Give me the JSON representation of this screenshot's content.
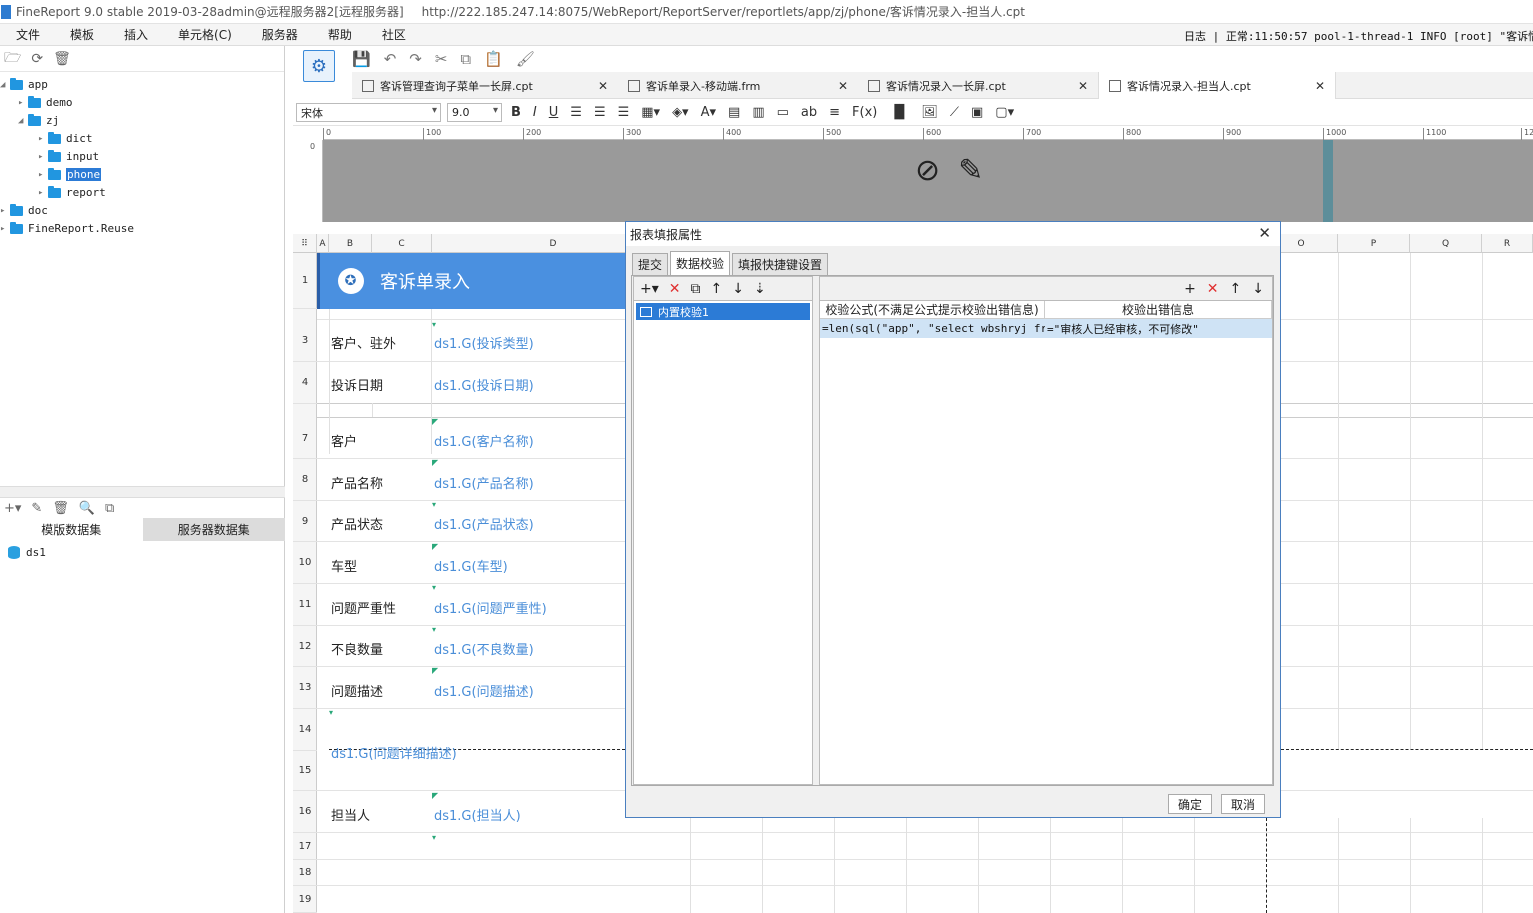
{
  "titlebar": {
    "title": "FineReport 9.0 stable 2019-03-28admin@远程服务器2[远程服务器]",
    "url": "http://222.185.247.14:8075/WebReport/ReportServer/reportlets/app/zj/phone/客诉情况录入-担当人.cpt"
  },
  "menu": {
    "items": [
      "文件",
      "模板",
      "插入",
      "单元格(C)",
      "服务器",
      "帮助",
      "社区"
    ],
    "log": "日志 | 正常:11:50:57 pool-1-thread-1 INFO [root] \"客诉情况"
  },
  "tree": {
    "nodes": [
      {
        "label": "app"
      },
      {
        "label": "demo"
      },
      {
        "label": "zj"
      },
      {
        "label": "dict"
      },
      {
        "label": "input"
      },
      {
        "label": "phone"
      },
      {
        "label": "report"
      },
      {
        "label": "doc"
      },
      {
        "label": "FineReport.Reuse"
      }
    ]
  },
  "datasets": {
    "tabs": [
      "模版数据集",
      "服务器数据集"
    ],
    "items": [
      "ds1"
    ]
  },
  "tabs": [
    {
      "label": "客诉管理查询子菜单一长屏.cpt"
    },
    {
      "label": "客诉单录入-移动端.frm"
    },
    {
      "label": "客诉情况录入一长屏.cpt"
    },
    {
      "label": "客诉情况录入-担当人.cpt"
    }
  ],
  "format": {
    "font": "宋体",
    "size": "9.0"
  },
  "ruler": [
    "0",
    "100",
    "200",
    "300",
    "400",
    "500",
    "600",
    "700",
    "800",
    "900",
    "1000",
    "1100",
    "12"
  ],
  "columns": [
    "A",
    "B",
    "C",
    "D",
    "O",
    "P",
    "Q",
    "R"
  ],
  "rows": [
    "1",
    "3",
    "4",
    "7",
    "8",
    "9",
    "10",
    "11",
    "12",
    "13",
    "14",
    "15",
    "16",
    "17",
    "18",
    "19"
  ],
  "sheet": {
    "header": "客诉单录入",
    "cells": [
      {
        "label": "客户、驻外",
        "value": "ds1.G(投诉类型)"
      },
      {
        "label": "投诉日期",
        "value": "ds1.G(投诉日期)"
      },
      {
        "label": "客户",
        "value": "ds1.G(客户名称)"
      },
      {
        "label": "产品名称",
        "value": "ds1.G(产品名称)"
      },
      {
        "label": "产品状态",
        "value": "ds1.G(产品状态)"
      },
      {
        "label": "车型",
        "value": "ds1.G(车型)"
      },
      {
        "label": "问题严重性",
        "value": "ds1.G(问题严重性)"
      },
      {
        "label": "不良数量",
        "value": "ds1.G(不良数量)"
      },
      {
        "label": "问题描述",
        "value": "ds1.G(问题描述)"
      },
      {
        "label": "",
        "value": "ds1.G(问题详细描述)"
      },
      {
        "label": "担当人",
        "value": "ds1.G(担当人)"
      }
    ]
  },
  "dialog": {
    "title": "报表填报属性",
    "tabs": [
      "提交",
      "数据校验",
      "填报快捷键设置"
    ],
    "list_item": "内置校验1",
    "col_formula": "校验公式(不满足公式提示校验出错信息)",
    "col_message": "校验出错信息",
    "row_formula": "=len(sql(\"app\", \"select wbshryj fr...",
    "row_message": "=\"审核人已经审核，不可修改\"",
    "ok": "确定",
    "cancel": "取消"
  }
}
